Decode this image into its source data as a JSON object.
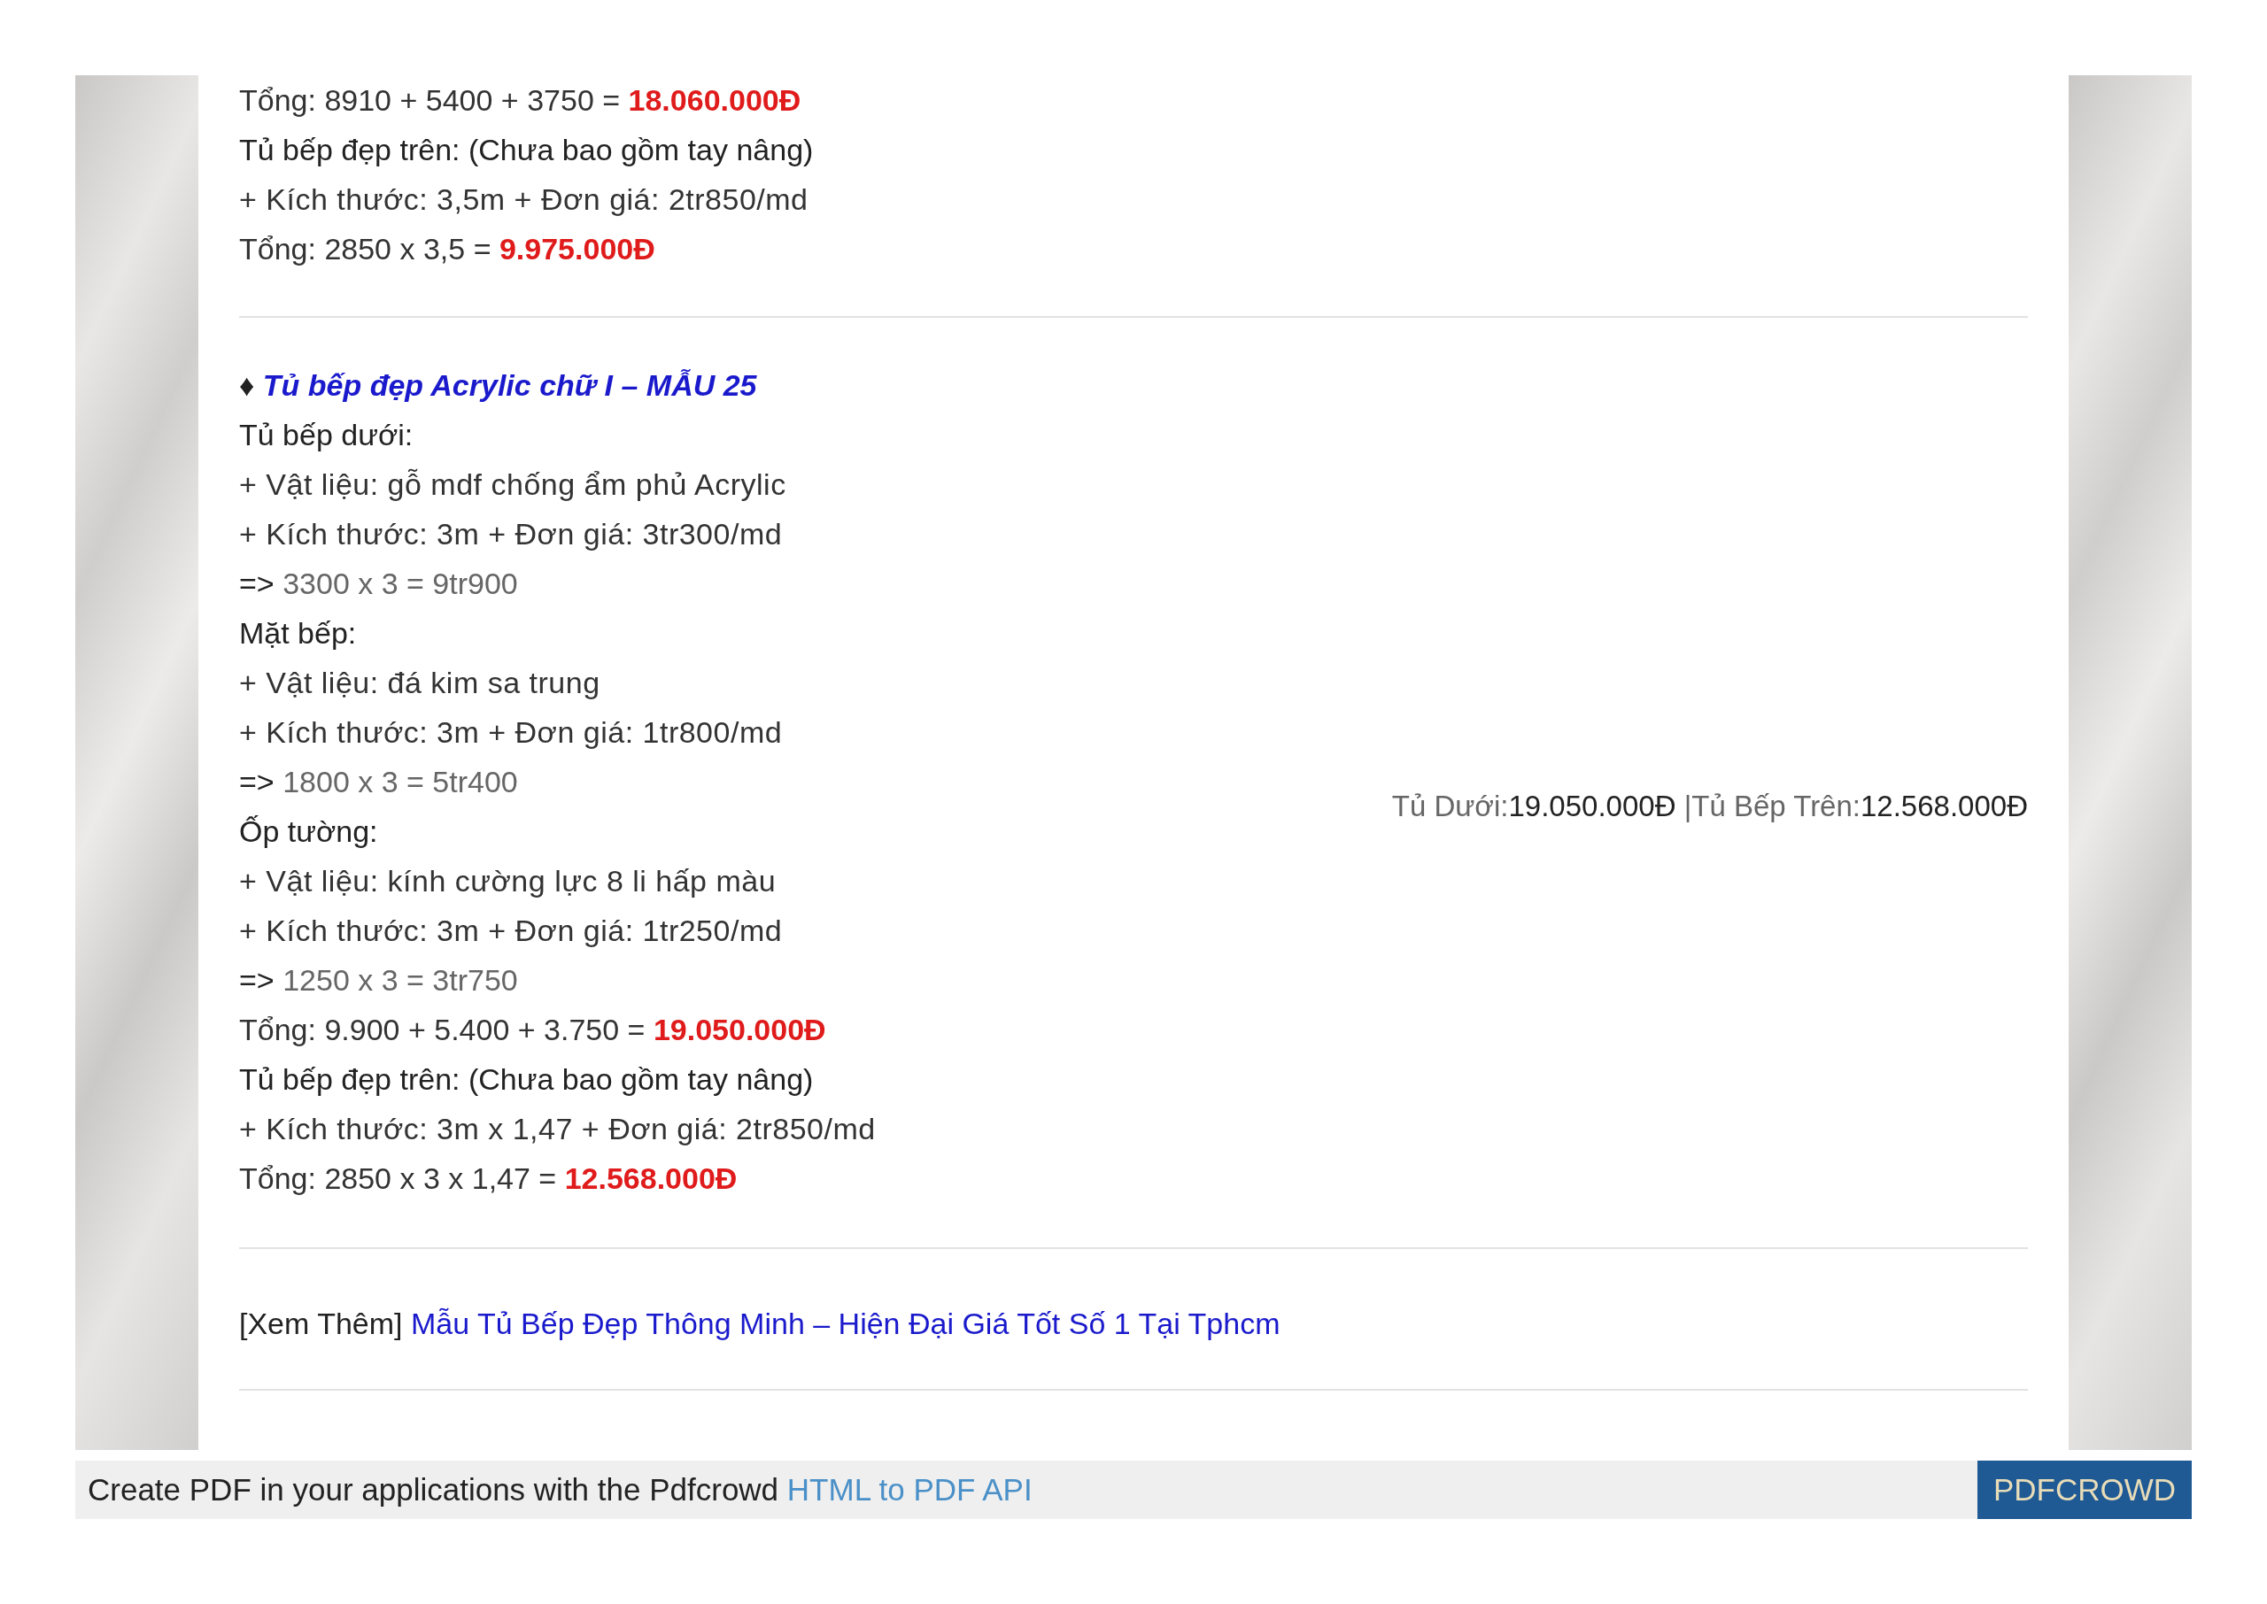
{
  "section_1": {
    "lines": [
      {
        "kind": "total",
        "text": "Tổng: 8910 + 5400 + 3750 = ",
        "amount": "18.060.000Đ"
      },
      {
        "kind": "label",
        "text": "Tủ bếp đẹp trên: (Chưa bao gồm tay nâng)"
      },
      {
        "kind": "text",
        "text": "+ Kích thước: 3,5m + Đơn giá: 2tr850/md"
      },
      {
        "kind": "total",
        "text": "Tổng: 2850 x 3,5 = ",
        "amount": "9.975.000Đ"
      }
    ]
  },
  "section_2": {
    "bullet": "♦",
    "title": "Tủ bếp đẹp Acrylic chữ I – MẪU 25",
    "lines": [
      {
        "kind": "label",
        "text": "Tủ bếp dưới:"
      },
      {
        "kind": "text",
        "text": "+ Vật liệu: gỗ mdf chống ẩm phủ Acrylic"
      },
      {
        "kind": "text",
        "text": "+ Kích thước: 3m + Đơn giá: 3tr300/md"
      },
      {
        "kind": "calc",
        "arrow": "=>",
        "text": "3300 x 3 = 9tr900"
      },
      {
        "kind": "label",
        "text": "Mặt bếp:"
      },
      {
        "kind": "text",
        "text": "+ Vật liệu: đá kim sa trung"
      },
      {
        "kind": "text",
        "text": "+ Kích thước: 3m + Đơn giá: 1tr800/md"
      },
      {
        "kind": "calc",
        "arrow": "=>",
        "text": "1800 x 3 = 5tr400"
      },
      {
        "kind": "label",
        "text": "Ốp tường:"
      },
      {
        "kind": "text",
        "text": "+ Vật liệu: kính cường lực 8 li hấp màu"
      },
      {
        "kind": "text",
        "text": "+ Kích thước: 3m + Đơn giá: 1tr250/md"
      },
      {
        "kind": "calc",
        "arrow": "=>",
        "text": "1250 x 3 = 3tr750"
      },
      {
        "kind": "total",
        "text": "Tổng: 9.900 + 5.400 + 3.750 = ",
        "amount": "19.050.000Đ"
      },
      {
        "kind": "label",
        "text": "Tủ bếp đẹp trên: (Chưa bao gồm tay nâng)"
      },
      {
        "kind": "text",
        "text": "+ Kích thước: 3m x 1,47 + Đơn giá: 2tr850/md"
      },
      {
        "kind": "total",
        "text": "Tổng: 2850 x 3 x 1,47 = ",
        "amount": "12.568.000Đ"
      }
    ],
    "summary": {
      "label_1": "Tủ Dưới:",
      "value_1": "19.050.000Đ",
      "label_2": " |Tủ Bếp Trên:",
      "value_2": "12.568.000Đ"
    }
  },
  "see_more": {
    "prefix": "[Xem Thêm]",
    "link": "Mẫu Tủ Bếp Đẹp Thông Minh – Hiện Đại Giá Tốt Số 1 Tại Tphcm"
  },
  "footer": {
    "text": "Create PDF in your applications with the Pdfcrowd",
    "link": "HTML to PDF API",
    "button": "PDFCROWD"
  }
}
